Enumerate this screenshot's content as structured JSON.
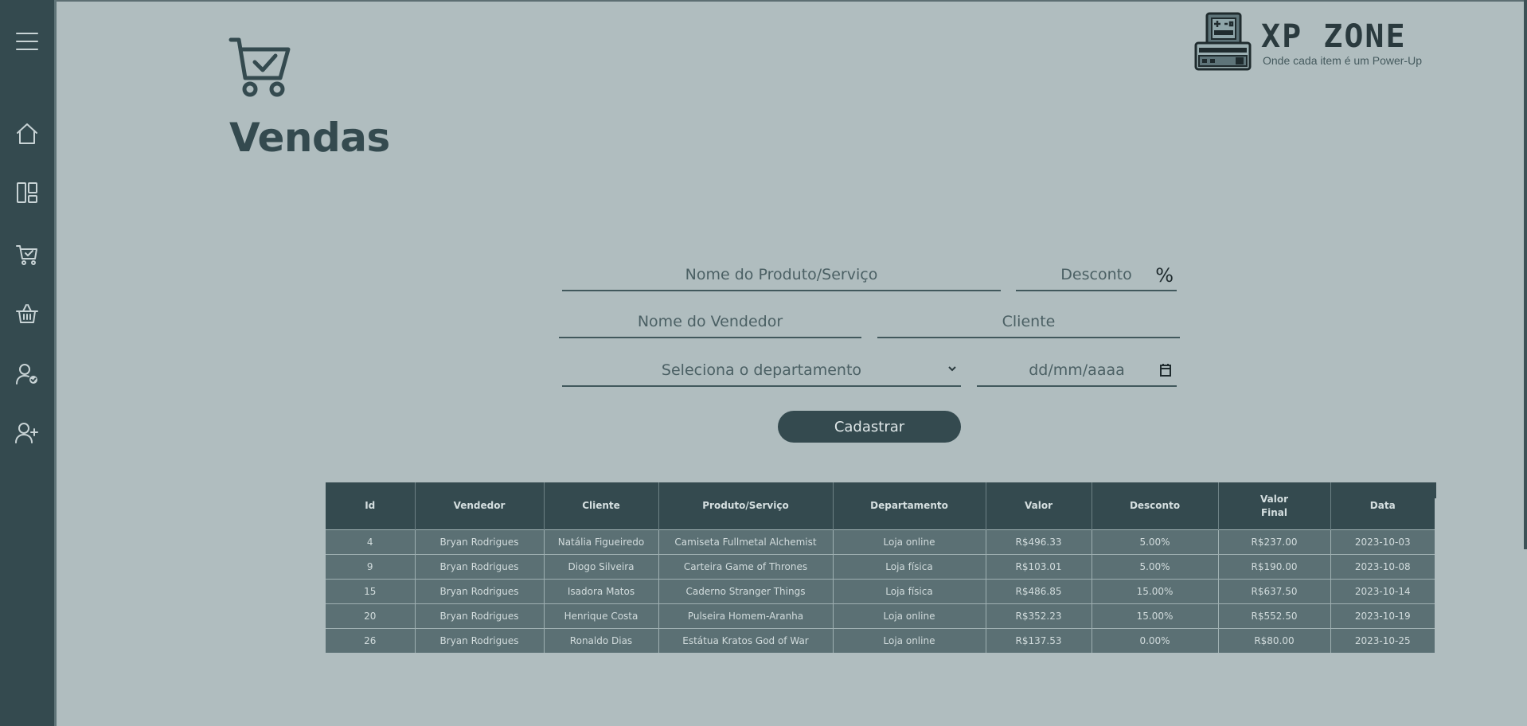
{
  "brand": {
    "name": "XP ZONE",
    "tagline": "Onde cada item é um Power-Up"
  },
  "sidebar": {
    "items": [
      {
        "icon": "menu-icon"
      },
      {
        "icon": "home-icon"
      },
      {
        "icon": "dashboard-icon"
      },
      {
        "icon": "cart-check-icon"
      },
      {
        "icon": "basket-icon"
      },
      {
        "icon": "user-check-icon"
      },
      {
        "icon": "user-add-icon"
      }
    ]
  },
  "page": {
    "title": "Vendas",
    "header_icon": "cart-check-icon"
  },
  "form": {
    "product_placeholder": "Nome do Produto/Serviço",
    "discount_placeholder": "Desconto",
    "discount_suffix": "%",
    "seller_placeholder": "Nome do Vendedor",
    "client_placeholder": "Cliente",
    "department_placeholder": "Seleciona o departamento",
    "date_placeholder": "dd/mm/aaaa",
    "submit_label": "Cadastrar"
  },
  "table": {
    "headers": [
      "Id",
      "Vendedor",
      "Cliente",
      "Produto/Serviço",
      "Departamento",
      "Valor",
      "Desconto",
      "Valor\nFinal",
      "Data"
    ],
    "rows": [
      [
        "4",
        "Bryan Rodrigues",
        "Natália Figueiredo",
        "Camiseta Fullmetal Alchemist",
        "Loja online",
        "R$496.33",
        "5.00%",
        "R$237.00",
        "2023-10-03"
      ],
      [
        "9",
        "Bryan Rodrigues",
        "Diogo Silveira",
        "Carteira Game of Thrones",
        "Loja física",
        "R$103.01",
        "5.00%",
        "R$190.00",
        "2023-10-08"
      ],
      [
        "15",
        "Bryan Rodrigues",
        "Isadora Matos",
        "Caderno Stranger Things",
        "Loja física",
        "R$486.85",
        "15.00%",
        "R$637.50",
        "2023-10-14"
      ],
      [
        "20",
        "Bryan Rodrigues",
        "Henrique Costa",
        "Pulseira Homem-Aranha",
        "Loja online",
        "R$352.23",
        "15.00%",
        "R$552.50",
        "2023-10-19"
      ],
      [
        "26",
        "Bryan Rodrigues",
        "Ronaldo Dias",
        "Estátua Kratos God of War",
        "Loja online",
        "R$137.53",
        "0.00%",
        "R$80.00",
        "2023-10-25"
      ]
    ]
  }
}
